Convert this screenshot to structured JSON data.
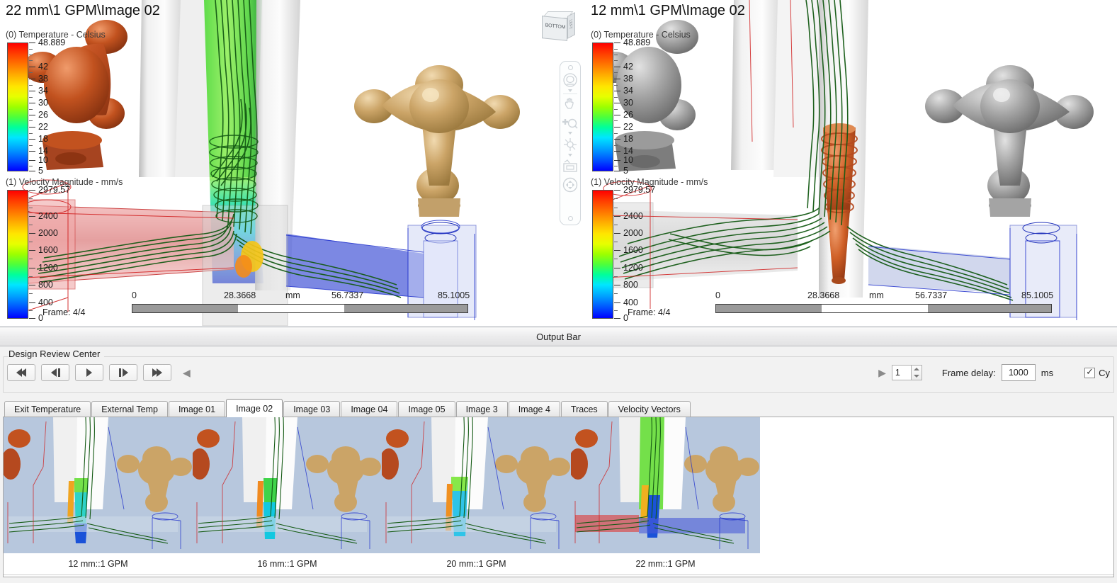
{
  "viewports": [
    {
      "title": "22 mm\\1 GPM\\Image 02",
      "temp_legend": {
        "title": "(0) Temperature - Celsius",
        "max": "48.889",
        "labels": [
          "48.889",
          "42",
          "38",
          "34",
          "30",
          "26",
          "22",
          "18",
          "14",
          "10",
          "5"
        ]
      },
      "velocity_legend": {
        "title": "(1) Velocity Magnitude - mm/s",
        "max": "2979.57",
        "labels": [
          "2979.57",
          "2400",
          "2000",
          "1600",
          "1200",
          "800",
          "400",
          "0"
        ]
      },
      "frame_counter": "Frame: 4/4",
      "ruler": {
        "ticks": [
          "0",
          "28.3668",
          "mm",
          "56.7337",
          "85.1005"
        ]
      }
    },
    {
      "title": "12 mm\\1 GPM\\Image 02",
      "temp_legend": {
        "title": "(0) Temperature - Celsius",
        "max": "48.889",
        "labels": [
          "48.889",
          "42",
          "38",
          "34",
          "30",
          "26",
          "22",
          "18",
          "14",
          "10",
          "5"
        ]
      },
      "velocity_legend": {
        "title": "(1) Velocity Magnitude - mm/s",
        "max": "2979.57",
        "labels": [
          "2979.57",
          "2400",
          "2000",
          "1600",
          "1200",
          "800",
          "400",
          "0"
        ]
      },
      "frame_counter": "Frame: 4/4",
      "ruler": {
        "ticks": [
          "0",
          "28.3668",
          "mm",
          "56.7337",
          "85.1005"
        ]
      }
    }
  ],
  "viewcube": {
    "face_label": "BOTTOM",
    "side_label": "LEFT"
  },
  "navbar": {
    "tools": [
      "orbit-icon",
      "pan-icon",
      "zoom-icon",
      "free-orbit-icon",
      "camera-icon",
      "fit-view-icon"
    ]
  },
  "output_bar": {
    "title": "Output Bar"
  },
  "design_review": {
    "title": "Design Review Center",
    "playback": {
      "buttons": [
        "skip-to-start-button",
        "step-backward-button",
        "play-button",
        "step-forward-button",
        "skip-to-end-button"
      ]
    },
    "frame_index": "1",
    "frame_delay_label": "Frame delay:",
    "frame_delay_value": "1000",
    "frame_delay_units": "ms",
    "cycle_label": "Cy",
    "cycle_checked": true
  },
  "tabs": [
    {
      "label": "Exit Temperature",
      "active": false
    },
    {
      "label": "External Temp",
      "active": false
    },
    {
      "label": "Image 01",
      "active": false
    },
    {
      "label": "Image 02",
      "active": true
    },
    {
      "label": "Image 03",
      "active": false
    },
    {
      "label": "Image 04",
      "active": false
    },
    {
      "label": "Image 05",
      "active": false
    },
    {
      "label": "Image 3",
      "active": false
    },
    {
      "label": "Image 4",
      "active": false
    },
    {
      "label": "Traces",
      "active": false
    },
    {
      "label": "Velocity Vectors",
      "active": false
    }
  ],
  "thumbnails": [
    {
      "caption": "12 mm::1 GPM"
    },
    {
      "caption": "16 mm::1 GPM"
    },
    {
      "caption": "20 mm::1 GPM"
    },
    {
      "caption": "22 mm::1 GPM"
    }
  ],
  "colors": {
    "legend_hot": "#ff0000",
    "legend_cold": "#0000ff",
    "streamline_green": "#145a14",
    "body_orange": "#b5491f",
    "body_gray": "#8d8d8d",
    "body_brass": "#c9a063",
    "thumb_bg": "#b7c7dd",
    "panel_bg": "#f2f2f2"
  }
}
